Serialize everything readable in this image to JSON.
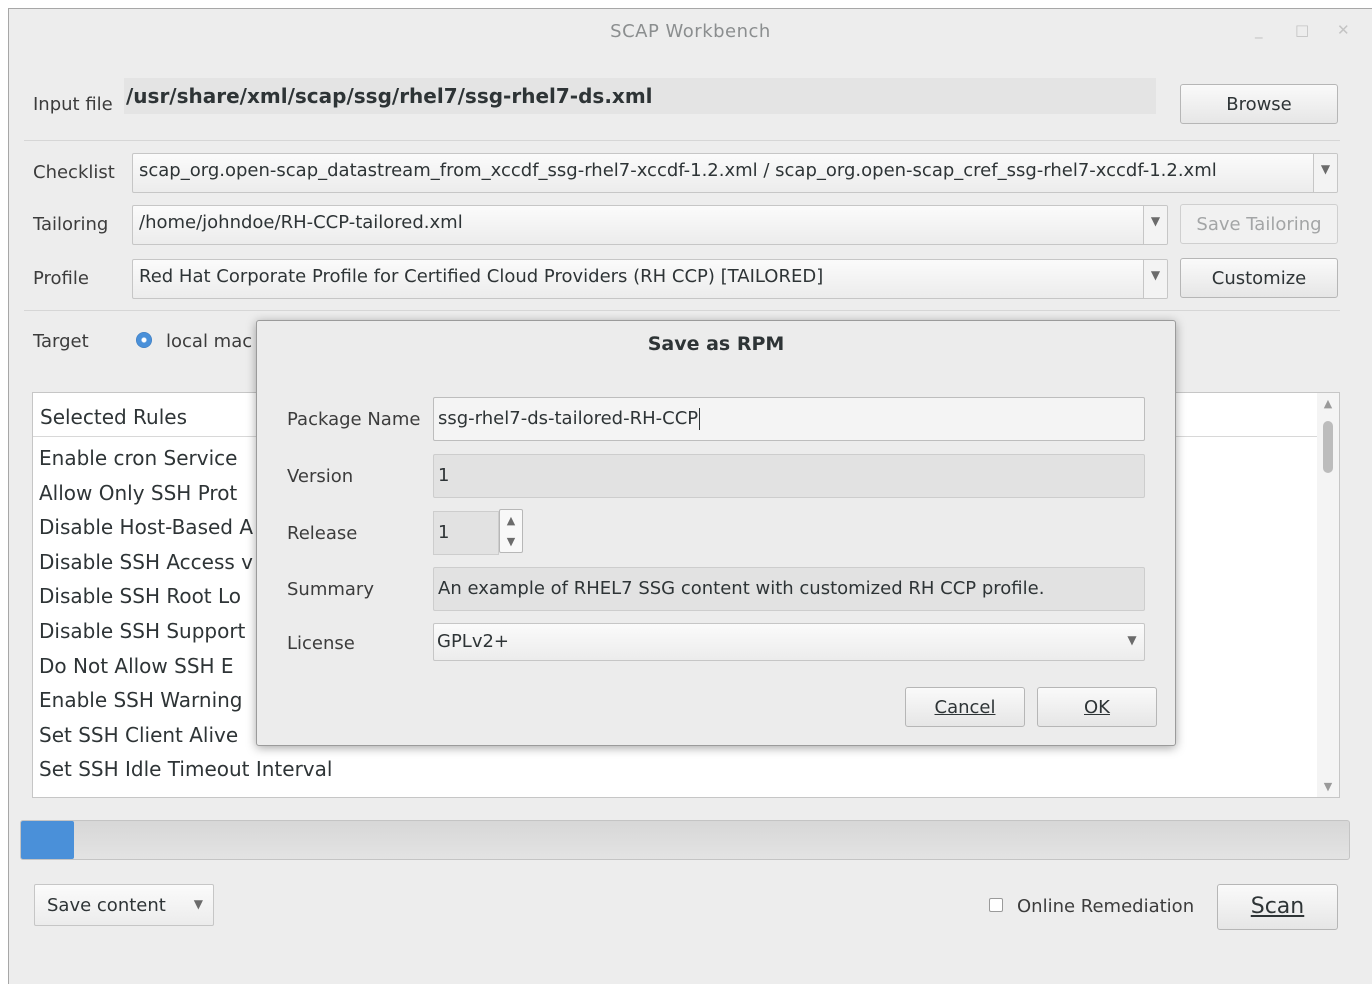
{
  "window": {
    "title": "SCAP Workbench",
    "controls": {
      "minimize": "_",
      "maximize": "□",
      "close": "✕"
    }
  },
  "main": {
    "input_file_label": "Input file",
    "input_file_path": "/usr/share/xml/scap/ssg/rhel7/ssg-rhel7-ds.xml",
    "browse_button": "Browse",
    "checklist_label": "Checklist",
    "checklist_value": "scap_org.open-scap_datastream_from_xccdf_ssg-rhel7-xccdf-1.2.xml / scap_org.open-scap_cref_ssg-rhel7-xccdf-1.2.xml",
    "tailoring_label": "Tailoring",
    "tailoring_value": "/home/johndoe/RH-CCP-tailored.xml",
    "save_tailoring_button": "Save Tailoring",
    "profile_label": "Profile",
    "profile_value": "Red Hat Corporate Profile for Certified Cloud Providers (RH CCP) [TAILORED]",
    "customize_button": "Customize",
    "target_label": "Target",
    "target_local_option": "local mac"
  },
  "rules": {
    "header": "Selected Rules",
    "items": [
      "Enable cron Service",
      "Allow Only SSH Prot",
      "Disable Host-Based A",
      "Disable SSH Access v",
      "Disable SSH Root Lo",
      "Disable SSH Support",
      "Do Not Allow SSH E",
      "Enable SSH Warning",
      "Set SSH Client Alive",
      "Set SSH Idle Timeout Interval"
    ]
  },
  "progress": {
    "fraction": 0.003,
    "color": "#4a90d9"
  },
  "bottom": {
    "save_content_button": "Save content",
    "online_remediation_label": "Online Remediation",
    "online_remediation_checked": false,
    "scan_button": "Scan"
  },
  "dialog": {
    "title": "Save as RPM",
    "package_name_label": "Package Name",
    "package_name_value": "ssg-rhel7-ds-tailored-RH-CCP",
    "version_label": "Version",
    "version_value": "1",
    "release_label": "Release",
    "release_value": "1",
    "summary_label": "Summary",
    "summary_value": "An example of RHEL7 SSG content with customized RH CCP profile.",
    "license_label": "License",
    "license_value": "GPLv2+",
    "cancel_button": "Cancel",
    "ok_button": "OK"
  },
  "icons": {
    "dropdown": "chevron-down-icon",
    "spin_up": "chevron-up-icon",
    "spin_down": "chevron-down-icon"
  }
}
